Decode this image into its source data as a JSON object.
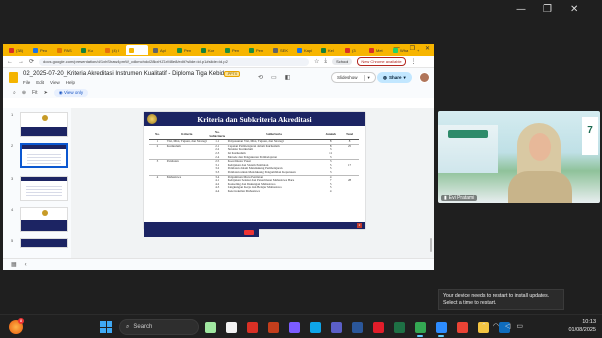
{
  "window_controls": {
    "minimize": "—",
    "maximize": "❐",
    "close": "✕"
  },
  "browser": {
    "tabs": [
      {
        "label": "(38)",
        "color": "#d93025"
      },
      {
        "label": "Peo",
        "color": "#1a73e8"
      },
      {
        "label": "PAS",
        "color": "#e37400"
      },
      {
        "label": "Ku",
        "color": "#188038"
      },
      {
        "label": "(4) I",
        "color": "#e8710a"
      },
      {
        "label": "",
        "color": "#f4b400",
        "active": true
      },
      {
        "label": "Apl",
        "color": "#5f6368"
      },
      {
        "label": "Pen",
        "color": "#1e8e3e"
      },
      {
        "label": "Kor",
        "color": "#188038"
      },
      {
        "label": "Pen",
        "color": "#1e8e3e"
      },
      {
        "label": "Pen",
        "color": "#1e8e3e"
      },
      {
        "label": "SEK",
        "color": "#5f6368"
      },
      {
        "label": "Kapi",
        "color": "#1a73e8"
      },
      {
        "label": "Kel",
        "color": "#188038"
      },
      {
        "label": "(3",
        "color": "#d93025"
      },
      {
        "label": "Met",
        "color": "#d93025"
      },
      {
        "label": "Wha",
        "color": "#25d366"
      }
    ],
    "new_tab": "+",
    "url": "docs.google.com/presentation/d/1xhShaw4pmW_cdkmchdcl28kxHZ1rM8e8/edit?slide=id.p1#slide=id.p2",
    "profile_label": "School",
    "update_label": "New Chrome available"
  },
  "slides": {
    "doc_title": "02_2025-07-20_Kriteria Akreditasi Instrumen Kualitatif - Diploma Tiga Kebid...",
    "file_badge": ".PPTX",
    "menu": [
      "File",
      "Edit",
      "View",
      "Help"
    ],
    "slideshow_label": "Slideshow",
    "share_label": "Share",
    "zoom_label": "Fit",
    "view_only_label": "View only",
    "thumbnail_numbers": [
      "1",
      "2",
      "3",
      "4",
      "5"
    ],
    "current_slide": {
      "title": "Kriteria dan Subkriteria Akreditasi",
      "headers": [
        "No.",
        "Kriteria",
        "No. Subkriteria",
        "Subkriteria",
        "Jumlah",
        "Total"
      ],
      "rows": [
        {
          "no": "1",
          "kriteria": "Visi, Misi, Tujuan, dan Strategi",
          "subno": "1.1",
          "sub": "Penyusunan Visi, Misi, Tujuan, dan Strategi",
          "jumlah": "8",
          "total": "8",
          "sep": true
        },
        {
          "no": "2",
          "kriteria": "Kurikulum",
          "subno": "2.1",
          "sub": "Capaian Pembelajaran dalam Kurikulum",
          "jumlah": "8",
          "total": "25",
          "sep": true
        },
        {
          "no": "",
          "kriteria": "",
          "subno": "2.2",
          "sub": "Struktur Kurikulum",
          "jumlah": "3",
          "total": ""
        },
        {
          "no": "",
          "kriteria": "",
          "subno": "2.3",
          "sub": "Isi Kurikulum",
          "jumlah": "11",
          "total": ""
        },
        {
          "no": "",
          "kriteria": "",
          "subno": "2.4",
          "sub": "Metode dan Pengukuran Pembelajaran",
          "jumlah": "3",
          "total": ""
        },
        {
          "no": "3",
          "kriteria": "Penilaian",
          "subno": "2.5",
          "sub": "Koordinator Pusat",
          "jumlah": "3",
          "total": "",
          "sep": true
        },
        {
          "no": "",
          "kriteria": "",
          "subno": "3.1",
          "sub": "Kebijakan dan Sistem Penilaian",
          "jumlah": "5",
          "total": "17"
        },
        {
          "no": "",
          "kriteria": "",
          "subno": "3.2",
          "sub": "Penilaian dalam Mendukung Pembelajaran",
          "jumlah": "5",
          "total": ""
        },
        {
          "no": "",
          "kriteria": "",
          "subno": "3.3",
          "sub": "Penilaian untuk Mendukung Pengambilan Keputusan",
          "jumlah": "3",
          "total": ""
        },
        {
          "no": "4",
          "kriteria": "Mahasiswa",
          "subno": "3.4",
          "sub": "Penjaminan Mutu Penilaian",
          "jumlah": "4",
          "total": "",
          "sep": true
        },
        {
          "no": "",
          "kriteria": "",
          "subno": "4.1",
          "sub": "Kebijakan Seleksi dan Penerimaan Mahasiswa Baru",
          "jumlah": "7",
          "total": "28"
        },
        {
          "no": "",
          "kriteria": "",
          "subno": "4.2",
          "sub": "Konseling dan Dukungan Mahasiswa",
          "jumlah": "5",
          "total": ""
        },
        {
          "no": "",
          "kriteria": "",
          "subno": "4.3",
          "sub": "Lingkungan Kerja dan Belajar Mahasiswa",
          "jumlah": "5",
          "total": ""
        },
        {
          "no": "",
          "kriteria": "",
          "subno": "4.4",
          "sub": "Keterwakilan Mahasiswa",
          "jumlah": "4",
          "total": ""
        }
      ],
      "page_number": "2"
    }
  },
  "video": {
    "participant_name": "Evi Pratami"
  },
  "toast": {
    "message": "Your device needs to restart to install updates. Select a time to restart."
  },
  "taskbar": {
    "notification_count": "8",
    "search_placeholder": "Search",
    "apps": [
      {
        "name": "copilot-app",
        "color": "#a0e7a0"
      },
      {
        "name": "file-app",
        "color": "#f2f2f2"
      },
      {
        "name": "acrobat-app",
        "color": "#d93025"
      },
      {
        "name": "powerpoint-app",
        "color": "#c43e1c"
      },
      {
        "name": "photos-app",
        "color": "#7b5cff"
      },
      {
        "name": "edge-app",
        "color": "#0ea5e9"
      },
      {
        "name": "teams-app",
        "color": "#5b5fc7"
      },
      {
        "name": "word-app",
        "color": "#2b579a"
      },
      {
        "name": "opera-app",
        "color": "#e11d2a"
      },
      {
        "name": "excel-app",
        "color": "#1e7145"
      },
      {
        "name": "chrome-app",
        "color": "#34a853",
        "active": true
      },
      {
        "name": "zoom-app",
        "color": "#2d8cff",
        "active": true
      },
      {
        "name": "meet-app",
        "color": "#ea4335"
      },
      {
        "name": "explorer-app",
        "color": "#f4c542"
      },
      {
        "name": "outlook-app",
        "color": "#0f6cbd"
      }
    ],
    "tray_icons": [
      "chevron-up",
      "wifi",
      "volume",
      "battery"
    ],
    "time": "10:13",
    "date": "01/08/2025"
  }
}
